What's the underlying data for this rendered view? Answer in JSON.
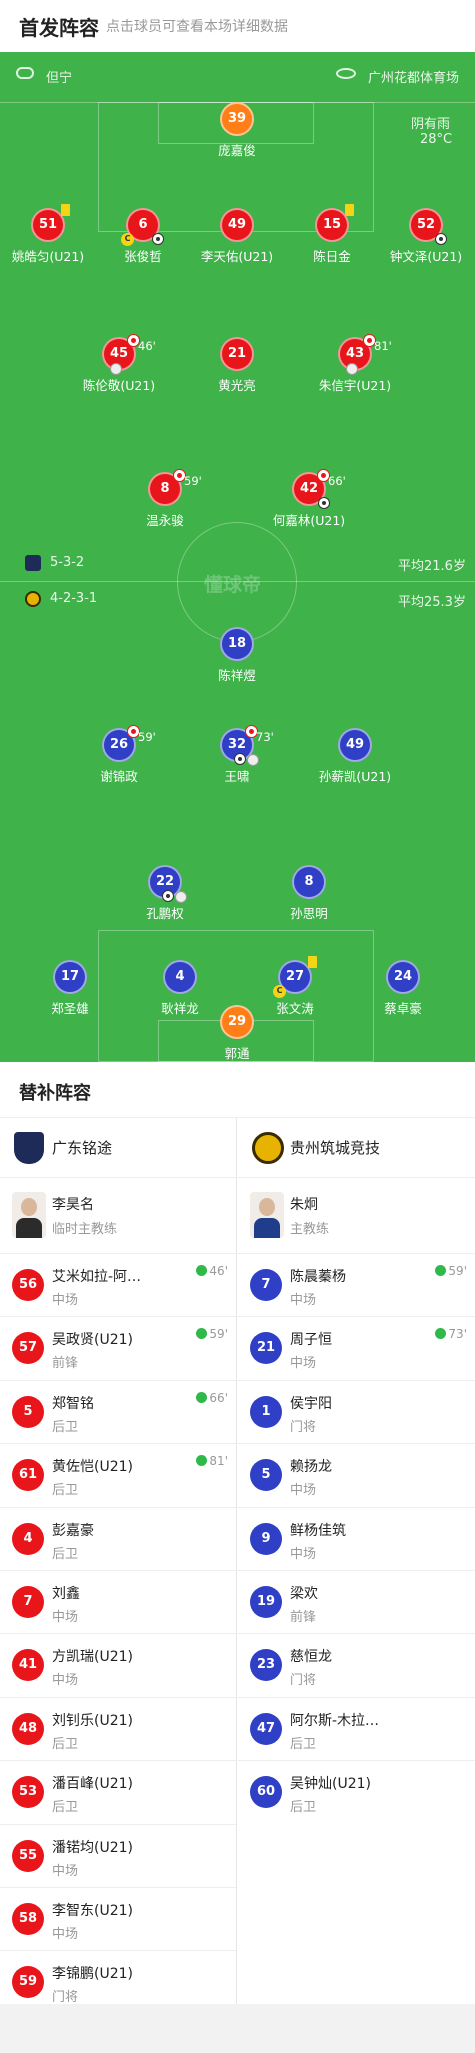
{
  "header": {
    "title": "首发阵容",
    "subtitle": "点击球员可查看本场详细数据"
  },
  "match": {
    "referee": "但宁",
    "venue": "广州花都体育场",
    "weather": "阴有雨",
    "temperature": "28°C",
    "watermark": "懂球帝"
  },
  "home_team": {
    "name": "广东铭途",
    "formation": "5-3-2",
    "avg_age": "平均21.6岁"
  },
  "away_team": {
    "name": "贵州筑城竞技",
    "formation": "4-2-3-1",
    "avg_age": "平均25.3岁"
  },
  "lineup_home": [
    {
      "num": "39",
      "name": "庞嘉俊"
    },
    {
      "num": "51",
      "name": "姚皓匀(U21)"
    },
    {
      "num": "6",
      "name": "张俊哲"
    },
    {
      "num": "49",
      "name": "李天佑(U21)"
    },
    {
      "num": "15",
      "name": "陈日金"
    },
    {
      "num": "52",
      "name": "钟文泽(U21)"
    },
    {
      "num": "45",
      "name": "陈伦敬(U21)",
      "sub_time": "46'"
    },
    {
      "num": "21",
      "name": "黄光亮"
    },
    {
      "num": "43",
      "name": "朱信宇(U21)",
      "sub_time": "81'"
    },
    {
      "num": "8",
      "name": "温永骏",
      "sub_time": "59'"
    },
    {
      "num": "42",
      "name": "何嘉林(U21)",
      "sub_time": "66'"
    }
  ],
  "lineup_away": [
    {
      "num": "18",
      "name": "陈祥煜"
    },
    {
      "num": "26",
      "name": "谢锦政",
      "sub_time": "59'"
    },
    {
      "num": "32",
      "name": "王啸",
      "sub_time": "73'"
    },
    {
      "num": "49",
      "name": "孙薪凯(U21)"
    },
    {
      "num": "22",
      "name": "孔鹏权"
    },
    {
      "num": "8",
      "name": "孙思明"
    },
    {
      "num": "17",
      "name": "郑圣雄"
    },
    {
      "num": "4",
      "name": "耿祥龙"
    },
    {
      "num": "27",
      "name": "张文涛"
    },
    {
      "num": "24",
      "name": "蔡卓豪"
    },
    {
      "num": "29",
      "name": "郭通"
    }
  ],
  "subs_section": {
    "title": "替补阵容"
  },
  "home_coach": {
    "name": "李昊名",
    "role": "临时主教练"
  },
  "away_coach": {
    "name": "朱炯",
    "role": "主教练"
  },
  "home_subs": [
    {
      "num": "56",
      "name": "艾米如拉-阿…",
      "pos": "中场",
      "sub_time": "46'"
    },
    {
      "num": "57",
      "name": "吴政贤(U21)",
      "pos": "前锋",
      "sub_time": "59'"
    },
    {
      "num": "5",
      "name": "郑智铭",
      "pos": "后卫",
      "sub_time": "66'"
    },
    {
      "num": "61",
      "name": "黄佐恺(U21)",
      "pos": "后卫",
      "sub_time": "81'"
    },
    {
      "num": "4",
      "name": "彭嘉豪",
      "pos": "后卫"
    },
    {
      "num": "7",
      "name": "刘鑫",
      "pos": "中场"
    },
    {
      "num": "41",
      "name": "方凯瑞(U21)",
      "pos": "中场"
    },
    {
      "num": "48",
      "name": "刘钊乐(U21)",
      "pos": "后卫"
    },
    {
      "num": "53",
      "name": "潘百峰(U21)",
      "pos": "后卫"
    },
    {
      "num": "55",
      "name": "潘锘均(U21)",
      "pos": "中场"
    },
    {
      "num": "58",
      "name": "李智东(U21)",
      "pos": "中场"
    },
    {
      "num": "59",
      "name": "李锦鹏(U21)",
      "pos": "门将"
    }
  ],
  "away_subs": [
    {
      "num": "7",
      "name": "陈晨蓁杨",
      "pos": "中场",
      "sub_time": "59'"
    },
    {
      "num": "21",
      "name": "周子恒",
      "pos": "中场",
      "sub_time": "73'"
    },
    {
      "num": "1",
      "name": "侯宇阳",
      "pos": "门将"
    },
    {
      "num": "5",
      "name": "赖扬龙",
      "pos": "中场"
    },
    {
      "num": "9",
      "name": "鲜杨佳筑",
      "pos": "中场"
    },
    {
      "num": "19",
      "name": "梁欢",
      "pos": "前锋"
    },
    {
      "num": "23",
      "name": "慈恒龙",
      "pos": "门将"
    },
    {
      "num": "47",
      "name": "阿尔斯-木拉…",
      "pos": "后卫"
    },
    {
      "num": "60",
      "name": "吴钟灿(U21)",
      "pos": "后卫"
    }
  ],
  "colors": {
    "pitch": "#3fb24a",
    "home": "#e8151b",
    "away": "#2f3fc6",
    "goalkeeper_home": "#ff7e17",
    "sub_in": "#2fb94a",
    "yellow_card": "#f5d418"
  },
  "icons": [
    "whistle-icon",
    "stadium-icon",
    "sub-off-icon",
    "goal-ball-icon",
    "own-goal-icon",
    "yellow-card-icon",
    "captain-icon",
    "sub-in-arrow-icon"
  ]
}
